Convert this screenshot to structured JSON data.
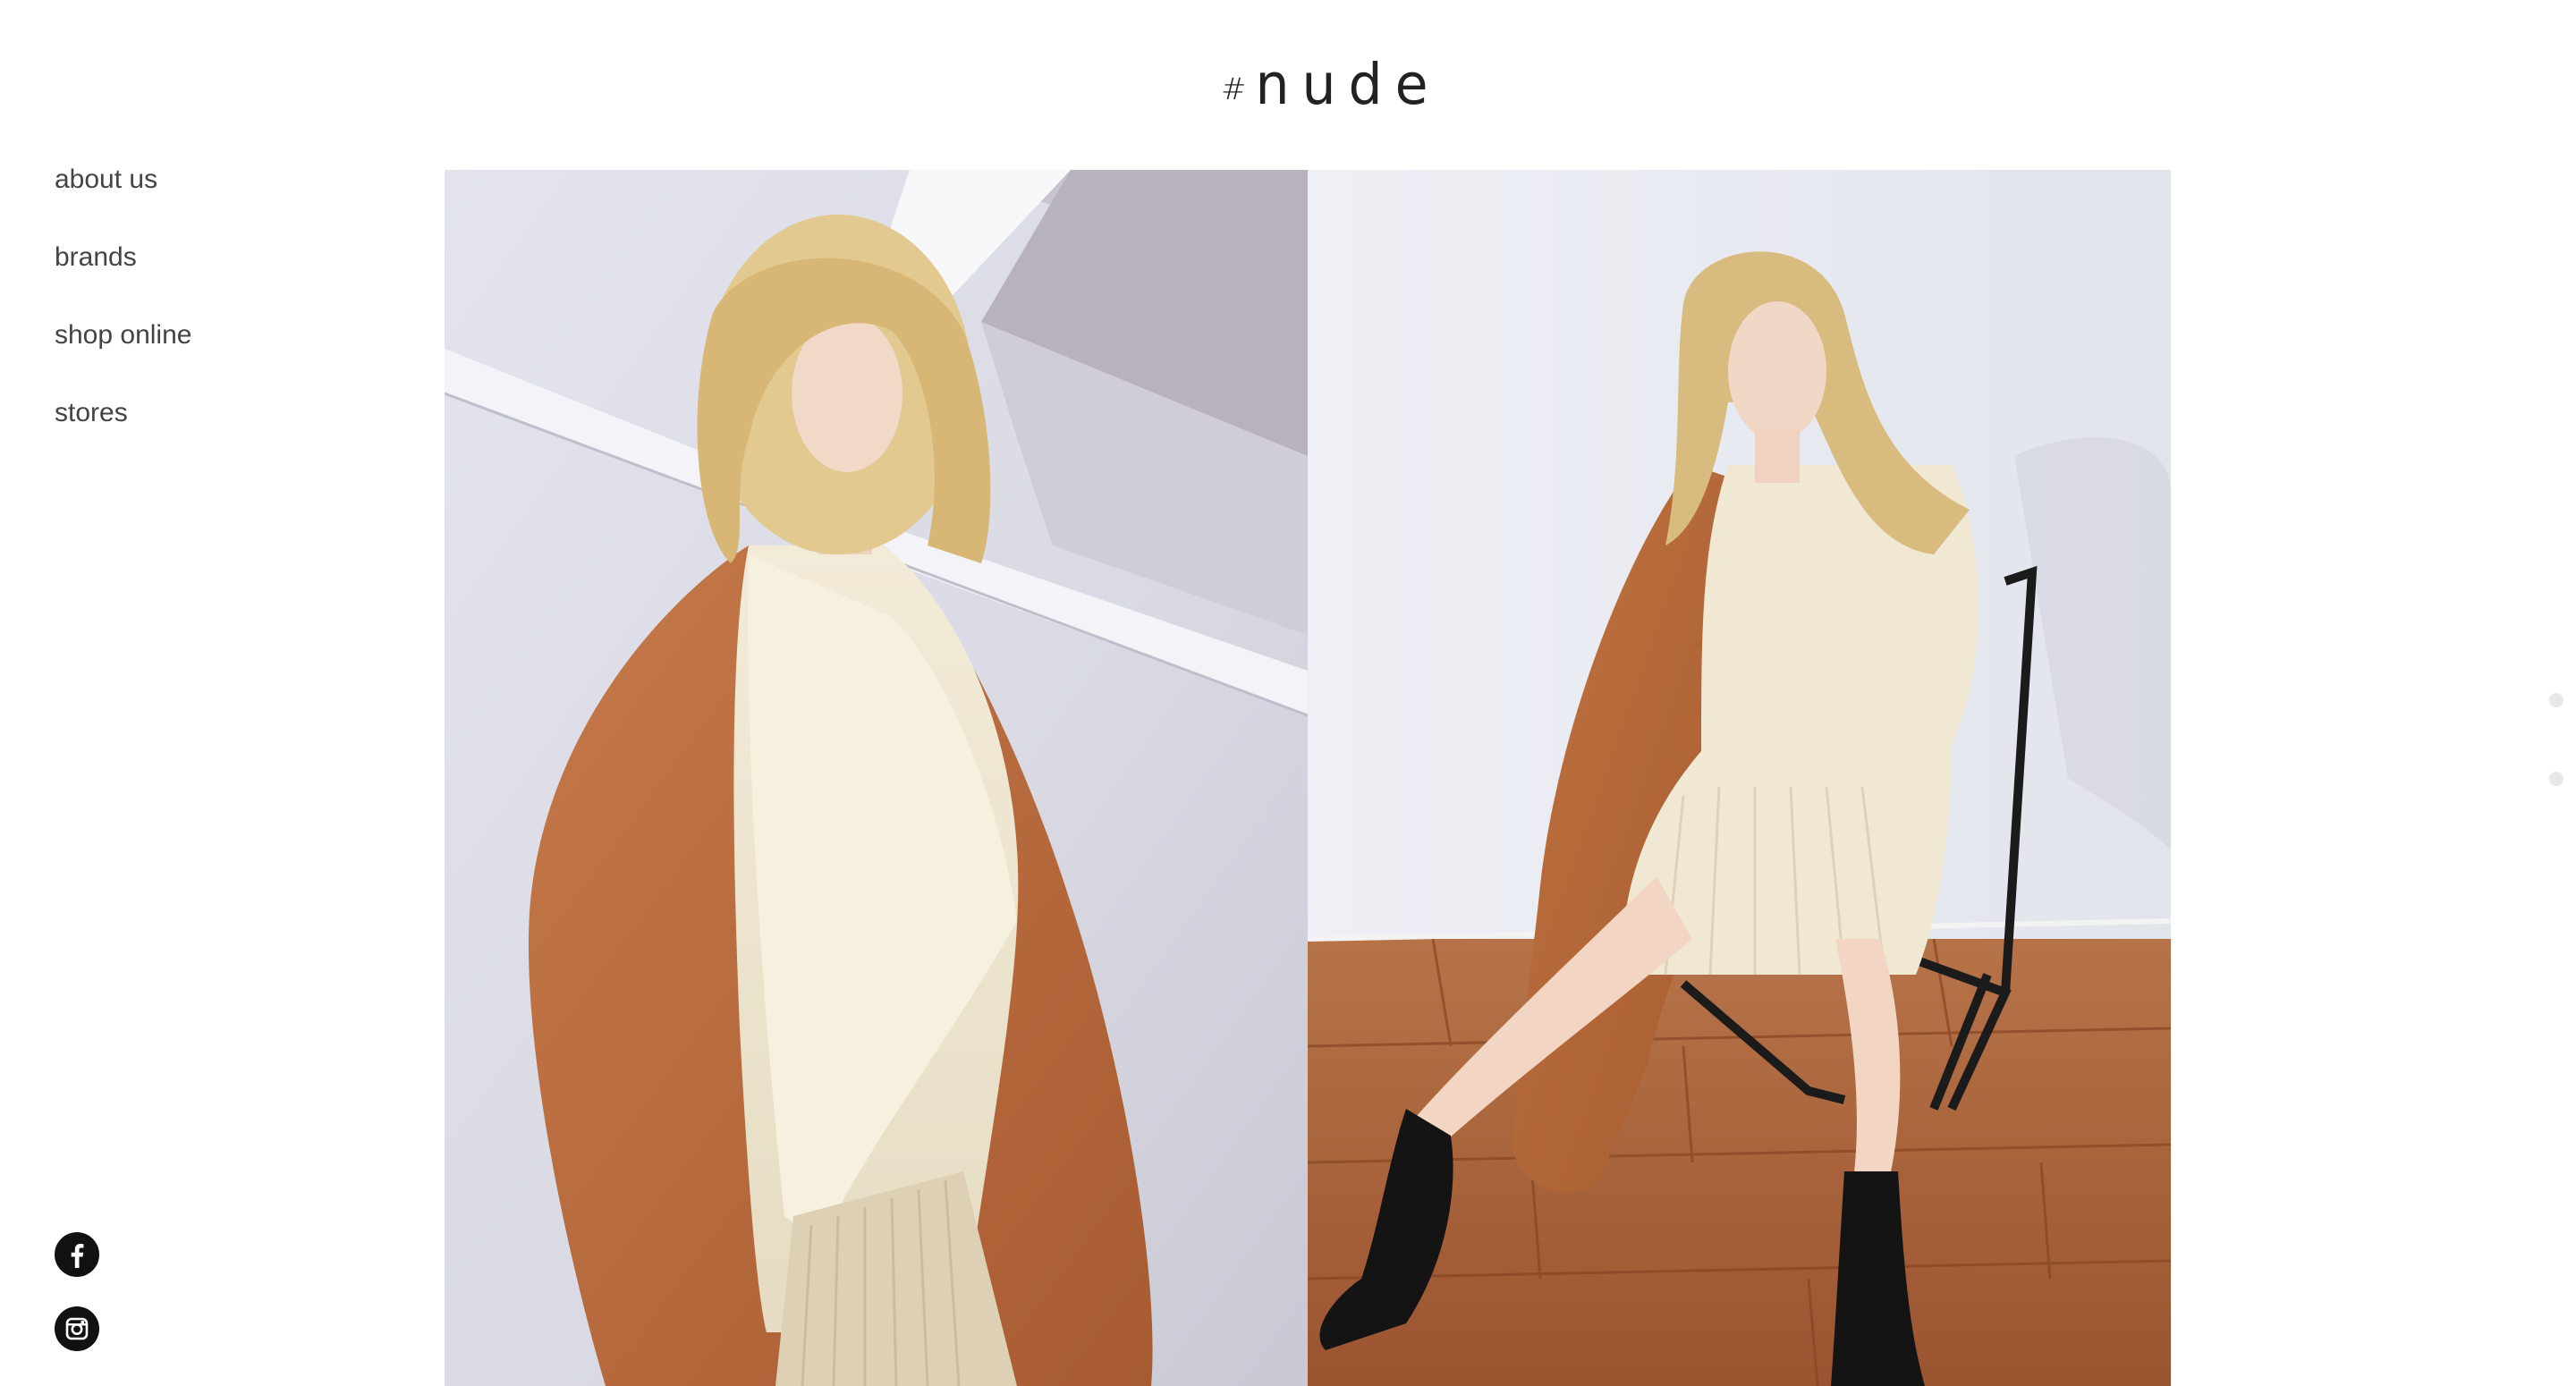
{
  "brand": {
    "hash": "#",
    "name": "nude"
  },
  "nav": {
    "items": [
      {
        "label": "about us"
      },
      {
        "label": "brands"
      },
      {
        "label": "shop online"
      },
      {
        "label": "stores"
      }
    ]
  },
  "social": [
    {
      "icon": "facebook-icon"
    },
    {
      "icon": "instagram-icon"
    }
  ],
  "gallery": {
    "photos": [
      {
        "subject": "model in camel coat and cream knit against white wall"
      },
      {
        "subject": "model seated on black chair on wooden floor"
      }
    ],
    "slide_count": 2,
    "active_slide": 1
  },
  "colors": {
    "background": "#ffffff",
    "text": "#444444",
    "coat": "#b5673a",
    "knit": "#efe6d2",
    "floor": "#a8623a",
    "wall": "#eceef3"
  }
}
